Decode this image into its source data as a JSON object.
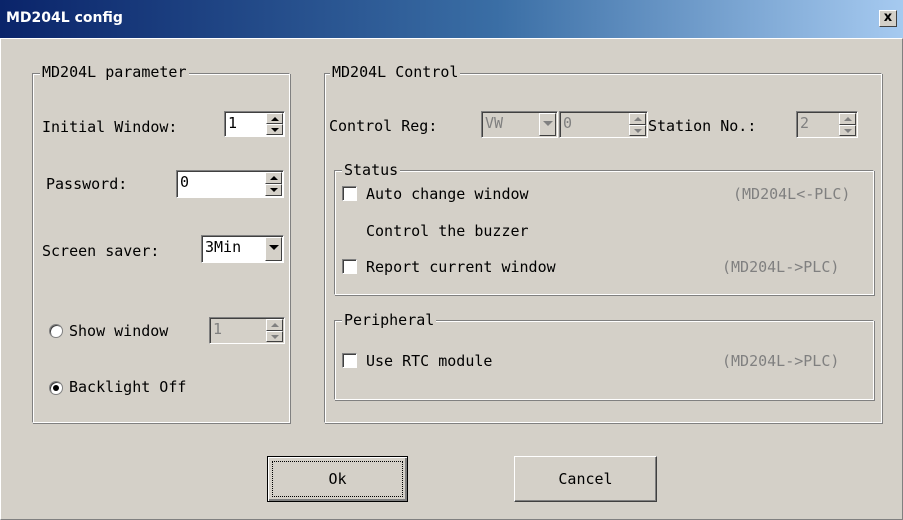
{
  "window": {
    "title": "MD204L config",
    "close_label": "x"
  },
  "parameter_group": {
    "legend": "MD204L parameter",
    "initial_window_label": "Initial Window:",
    "initial_window_value": "1",
    "password_label": "Password:",
    "password_value": "0",
    "screen_saver_label": "Screen saver:",
    "screen_saver_value": "3Min",
    "show_window_label": "Show window",
    "show_window_value": "1",
    "backlight_off_label": "Backlight Off"
  },
  "control_group": {
    "legend": "MD204L Control",
    "control_reg_label": "Control Reg:",
    "control_reg_type": "VW",
    "control_reg_value": "0",
    "station_no_label": "Station No.:",
    "station_no_value": "2",
    "status": {
      "legend": "Status",
      "auto_change_label": "Auto change window",
      "auto_change_direction": "(MD204L<-PLC)",
      "buzzer_label": "Control the buzzer",
      "report_window_label": "Report current window",
      "report_window_direction": "(MD204L->PLC)"
    },
    "peripheral": {
      "legend": "Peripheral",
      "rtc_label": "Use RTC module",
      "rtc_direction": "(MD204L->PLC)"
    }
  },
  "buttons": {
    "ok": "Ok",
    "cancel": "Cancel"
  }
}
